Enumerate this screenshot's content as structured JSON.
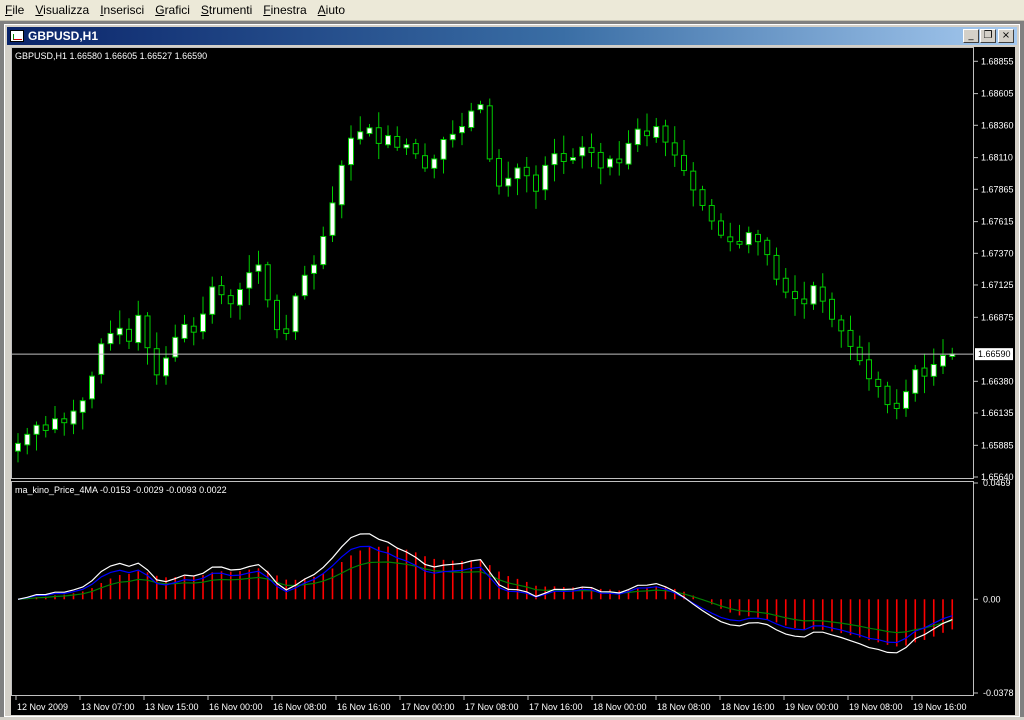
{
  "menu": [
    "File",
    "Visualizza",
    "Inserisci",
    "Grafici",
    "Strumenti",
    "Finestra",
    "Aiuto"
  ],
  "window": {
    "title": "GBPUSD,H1",
    "minimize": "_",
    "restore": "❐",
    "close": "×"
  },
  "colors": {
    "bull": "#ffffff",
    "wick": "#00cc00",
    "bidline": "#c0c0c0",
    "hist": "#ff0000",
    "line_white": "#ffffff",
    "line_blue": "#0000ff",
    "line_green": "#008000"
  },
  "price_panel": {
    "label": "GBPUSD,H1  1.66580 1.66605 1.66527 1.66590",
    "y_ticks": [
      "1.68855",
      "1.68605",
      "1.68360",
      "1.68110",
      "1.67865",
      "1.67615",
      "1.67370",
      "1.67125",
      "1.66875",
      "1.66380",
      "1.66135",
      "1.65885",
      "1.65640"
    ],
    "current_price": "1.66590"
  },
  "indicator_panel": {
    "label": "ma_kino_Price_4MA -0.0153 -0.0029 -0.0093 0.0022",
    "y_ticks": [
      "0.0469",
      "0.00",
      "-0.0378"
    ]
  },
  "time_axis": [
    "12 Nov 2009",
    "13 Nov 07:00",
    "13 Nov 15:00",
    "16 Nov 00:00",
    "16 Nov 08:00",
    "16 Nov 16:00",
    "17 Nov 00:00",
    "17 Nov 08:00",
    "17 Nov 16:00",
    "18 Nov 00:00",
    "18 Nov 08:00",
    "18 Nov 16:00",
    "19 Nov 00:00",
    "19 Nov 08:00",
    "19 Nov 16:00"
  ],
  "chart_data": {
    "type": "candlestick",
    "price": {
      "ylim": [
        1.6564,
        1.6895
      ],
      "bid": 1.6659,
      "closes": [
        1.659,
        1.6597,
        1.6604,
        1.66,
        1.6609,
        1.6606,
        1.6615,
        1.6623,
        1.6642,
        1.6667,
        1.6675,
        1.6679,
        1.6669,
        1.6689,
        1.6664,
        1.6643,
        1.6656,
        1.6672,
        1.6682,
        1.6676,
        1.669,
        1.6711,
        1.6705,
        1.6698,
        1.6709,
        1.6722,
        1.6728,
        1.6701,
        1.6678,
        1.6675,
        1.6704,
        1.672,
        1.6728,
        1.675,
        1.6776,
        1.6805,
        1.6826,
        1.6831,
        1.6834,
        1.6822,
        1.6828,
        1.6819,
        1.6821,
        1.6814,
        1.6803,
        1.681,
        1.6825,
        1.6829,
        1.6835,
        1.6847,
        1.6852,
        1.681,
        1.6789,
        1.6795,
        1.6803,
        1.6797,
        1.6785,
        1.6805,
        1.6814,
        1.6808,
        1.6811,
        1.6819,
        1.6815,
        1.6803,
        1.681,
        1.6807,
        1.6822,
        1.6833,
        1.6828,
        1.6835,
        1.6823,
        1.6813,
        1.6801,
        1.6786,
        1.6774,
        1.6762,
        1.6751,
        1.6746,
        1.6744,
        1.6753,
        1.6746,
        1.6736,
        1.6717,
        1.6707,
        1.6702,
        1.6698,
        1.6712,
        1.67,
        1.6686,
        1.6677,
        1.6665,
        1.6654,
        1.664,
        1.6634,
        1.662,
        1.6617,
        1.663,
        1.6647,
        1.6642,
        1.6651,
        1.6658,
        1.6659
      ],
      "last_bar": {
        "open": 1.6658,
        "high": 1.66605,
        "low": 1.66527,
        "close": 1.6659
      }
    },
    "indicator": {
      "ylim": [
        -0.0378,
        0.0469
      ],
      "last": {
        "white": -0.0153,
        "green": -0.0029,
        "blue": -0.0093,
        "hist": 0.0022
      }
    }
  }
}
